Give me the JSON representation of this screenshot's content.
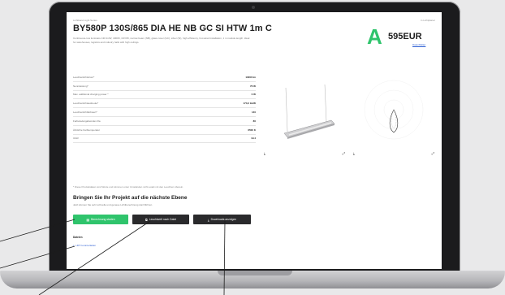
{
  "product": {
    "breadcrumb": "Lichtband Light Series",
    "title": "BY580P 130S/865 DIA HE NB GC SI HTW 1m C",
    "description": "Continuous-row luminaire 130 lm/W, 4000K, CRI 80, narrow beam (NB), glass cover (GC), silver (SI), high efficiency, hot-wired installation, 1 m module length. Ideal for warehouses, logistics and industry halls with high ceilings.",
    "corner_label": "in Lichtplaner",
    "energy_class": "A",
    "price": "595EUR",
    "price_link": "Datenblätter"
  },
  "specs": [
    {
      "label": "Leuchtenlichtstrom*",
      "value": "13000 lm"
    },
    {
      "label": "Nennleistung*",
      "value": "76 W"
    },
    {
      "label": "Max. additional charging power *",
      "value": "0 W"
    },
    {
      "label": "Leuchtenlichtausbeute*",
      "value": "170,2 lm/W"
    },
    {
      "label": "Leuchtenlichtfarbwert*",
      "value": "140"
    },
    {
      "label": "Farbwiedergabeindex Ra",
      "value": "80"
    },
    {
      "label": "Ähnliche Farbtemperatur",
      "value": "6500 K"
    },
    {
      "label": "UGR",
      "value": "19.4"
    }
  ],
  "note": "* Diese Produktdaten sind Werte und stimmen unter Umständen nicht exakt mit den Leuchten überein.",
  "cta": {
    "title": "Bringen Sie Ihr Projekt auf die nächste Ebene",
    "subtitle": "Jetzt können Sie sehr schnelle und genaue Lichtberechnung durchführen",
    "btn_calc": "Berechnung starten",
    "btn_compare": "Leuchtwelt nach Datei",
    "btn_download": "Downloads anzeigen"
  },
  "files": {
    "label": "Dateien",
    "link": "LDT herunterladen"
  },
  "icons": {
    "calc": "calculator-icon",
    "compare": "compare-icon",
    "download": "download-icon",
    "expand": "expand-icon",
    "file": "file-icon"
  },
  "colors": {
    "accent_green": "#2fc46c",
    "dark_button": "#2a2a2c",
    "link_blue": "#2d5fd3"
  }
}
